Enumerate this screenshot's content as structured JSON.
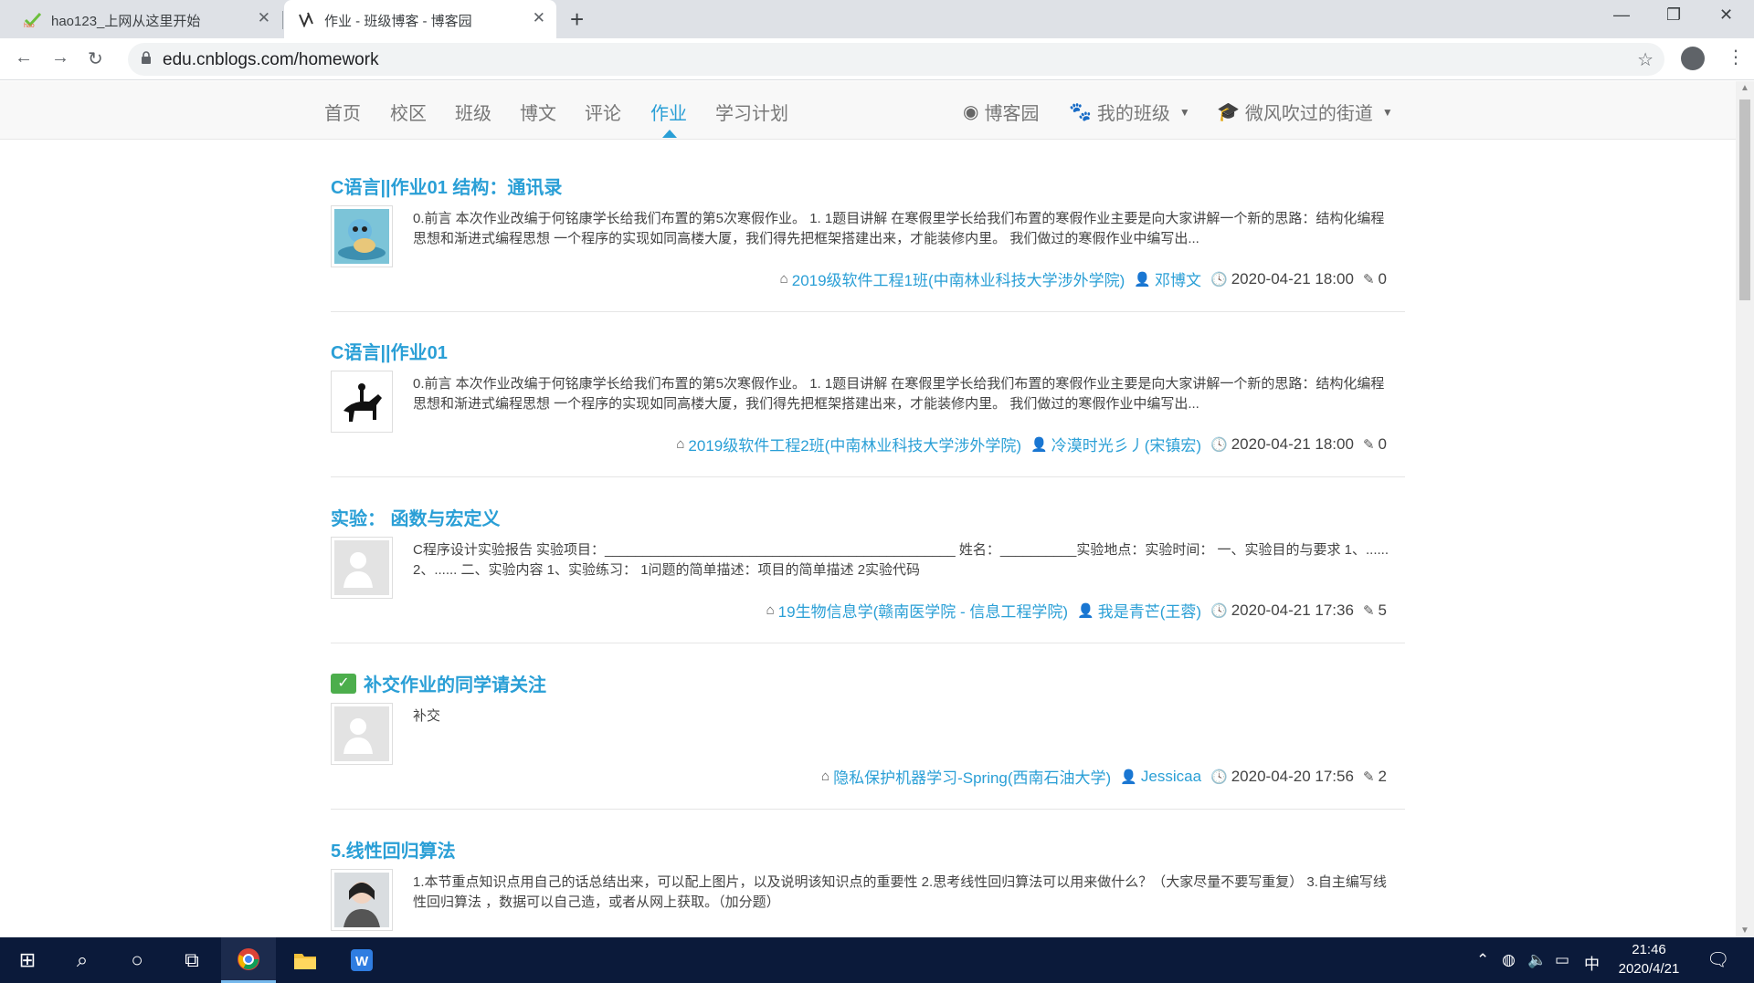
{
  "browser": {
    "tabs": [
      {
        "title": "hao123_上网从这里开始",
        "active": false
      },
      {
        "title": "作业 - 班级博客 - 博客园",
        "active": true
      }
    ],
    "url": "edu.cnblogs.com/homework"
  },
  "site_nav": {
    "links": [
      "首页",
      "校区",
      "班级",
      "博文",
      "评论",
      "作业",
      "学习计划"
    ],
    "active": "作业",
    "right": {
      "cnblogs": "博客园",
      "my_class": "我的班级",
      "user": "微风吹过的街道"
    }
  },
  "homework": [
    {
      "title": "C语言||作业01 结构：通讯录",
      "summary": "0.前言 本次作业改编于何铭康学长给我们布置的第5次寒假作业。 1. 1题目讲解 在寒假里学长给我们布置的寒假作业主要是向大家讲解一个新的思路：结构化编程思想和渐进式编程思想 一个程序的实现如同高楼大厦，我们得先把框架搭建出来，才能装修内里。 我们做过的寒假作业中编写出...",
      "class": "2019级软件工程1班(中南林业科技大学涉外学院)",
      "author": "邓博文",
      "time": "2020-04-21 18:00",
      "count": "0",
      "thumb": "squirtle"
    },
    {
      "title": "C语言||作业01",
      "summary": "0.前言 本次作业改编于何铭康学长给我们布置的第5次寒假作业。 1. 1题目讲解 在寒假里学长给我们布置的寒假作业主要是向大家讲解一个新的思路：结构化编程思想和渐进式编程思想 一个程序的实现如同高楼大厦，我们得先把框架搭建出来，才能装修内里。 我们做过的寒假作业中编写出...",
      "class": "2019级软件工程2班(中南林业科技大学涉外学院)",
      "author": "冷漠时光彡丿(宋镇宏)",
      "time": "2020-04-21 18:00",
      "count": "0",
      "thumb": "rider"
    },
    {
      "title": "实验： 函数与宏定义",
      "summary": "C程序设计实验报告 实验项目：______________________________________________ 姓名：__________实验地点：实验时间： 一、实验目的与要求 1、...... 2、...... 二、实验内容 1、实验练习： 1问题的简单描述：项目的简单描述 2实验代码",
      "class": "19生物信息学(赣南医学院 - 信息工程学院)",
      "author": "我是青芒(王蓉)",
      "time": "2020-04-21 17:36",
      "count": "5",
      "thumb": "placeholder"
    },
    {
      "title": "补交作业的同学请关注",
      "summary": "补交",
      "class": "隐私保护机器学习-Spring(西南石油大学)",
      "author": "Jessicaa",
      "time": "2020-04-20 17:56",
      "count": "2",
      "thumb": "placeholder",
      "checked": true
    },
    {
      "title": "5.线性回归算法",
      "summary": "1.本节重点知识点用自己的话总结出来，可以配上图片，以及说明该知识点的重要性 2.思考线性回归算法可以用来做什么？（大家尽量不要写重复） 3.自主编写线性回归算法 ，数据可以自己造，或者从网上获取。（加分题）",
      "class": "",
      "author": "",
      "time": "",
      "count": "",
      "thumb": "portrait"
    }
  ],
  "taskbar": {
    "ime": "中",
    "time": "21:46",
    "date": "2020/4/21"
  },
  "colors": {
    "link": "#2a9fd6",
    "taskbar": "#0b1a3a",
    "check": "#4cae4c"
  }
}
